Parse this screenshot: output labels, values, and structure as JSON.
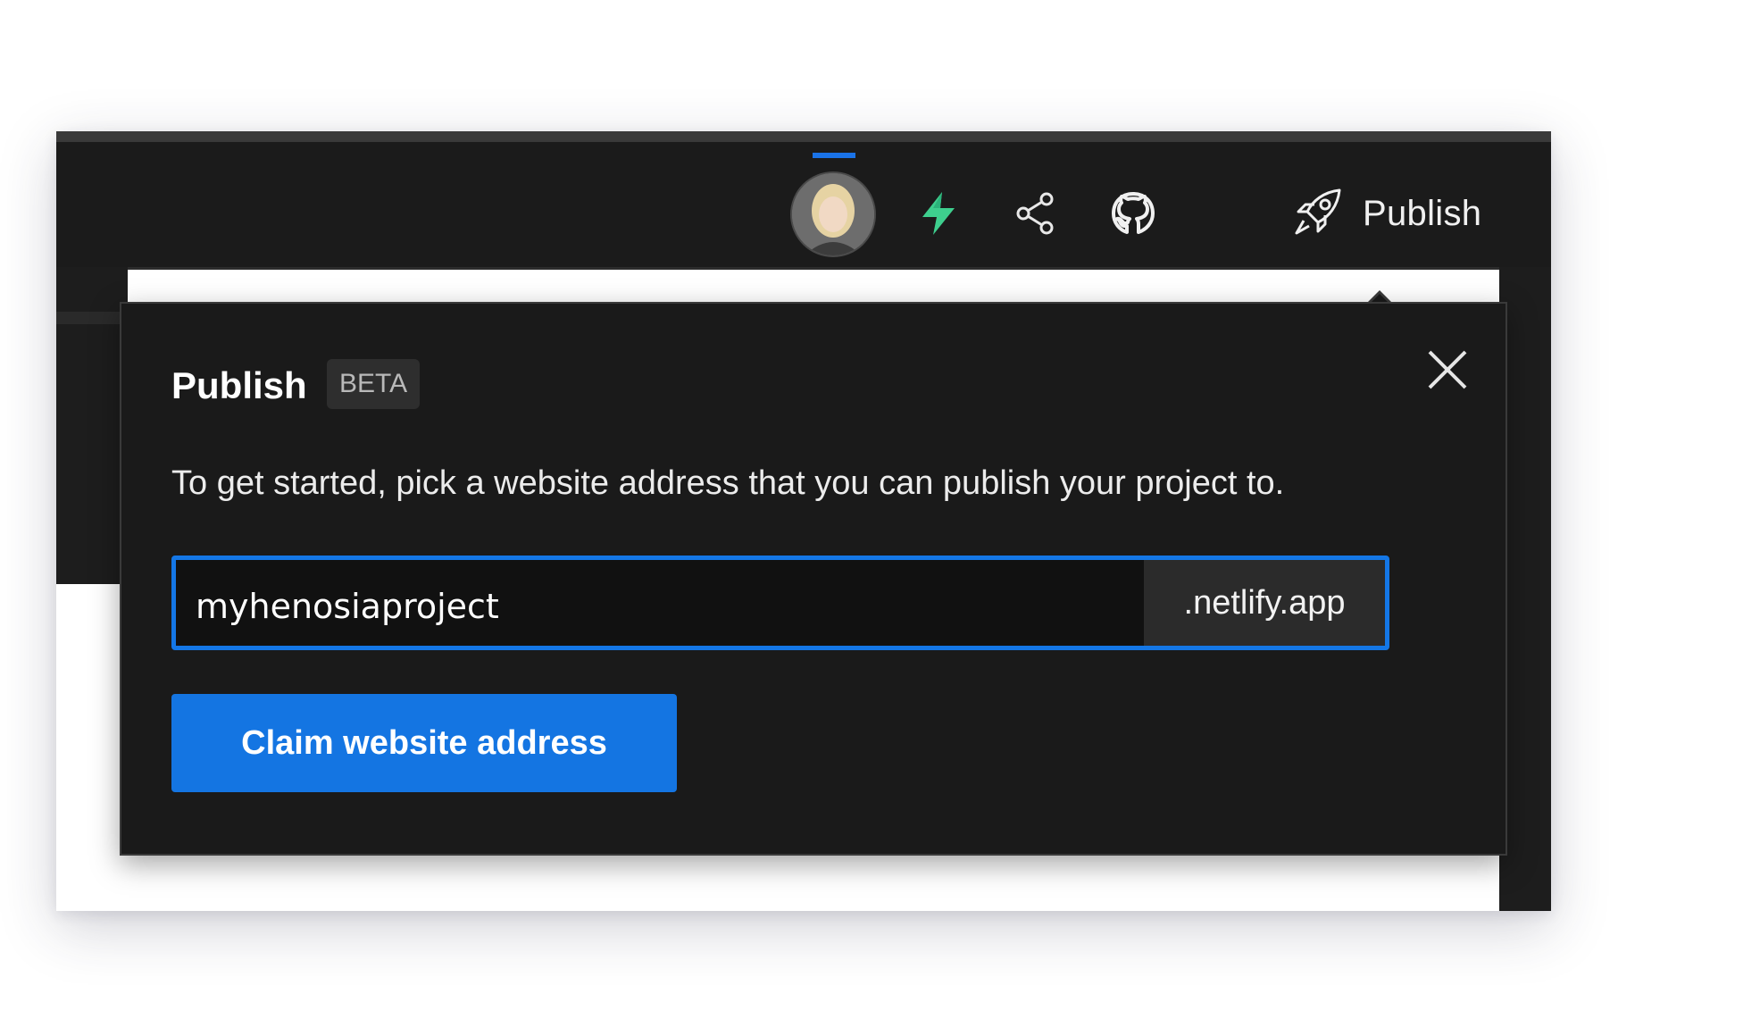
{
  "toolbar": {
    "publish_label": "Publish",
    "icons": [
      "avatar",
      "lightning-icon",
      "share-icon",
      "github-icon",
      "rocket-icon"
    ]
  },
  "popover": {
    "title": "Publish",
    "badge": "BETA",
    "description": "To get started, pick a website address that you can publish your project to.",
    "address_value": "myhenosiaproject",
    "address_suffix": ".netlify.app",
    "claim_button_label": "Claim website address"
  },
  "colors": {
    "accent": "#1475e2",
    "lightning": "#3ecf8e",
    "background_dark": "#1a1a1a"
  }
}
